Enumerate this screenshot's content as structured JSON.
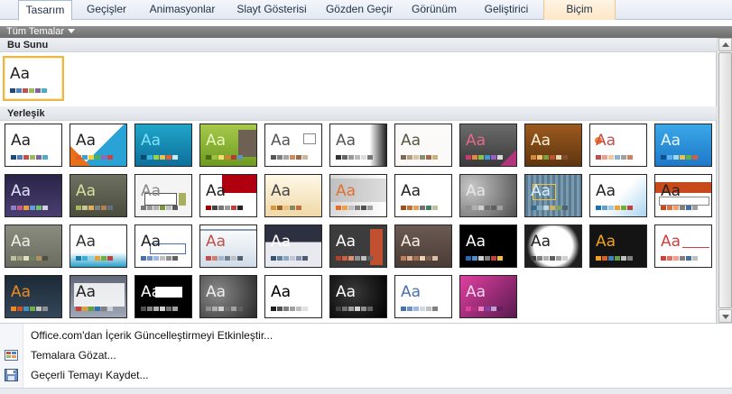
{
  "ribbon": {
    "tabs": [
      "Tasarım",
      "Geçişler",
      "Animasyonlar",
      "Slayt Gösterisi",
      "Gözden Geçir",
      "Görünüm",
      "Geliştirici",
      "Biçim"
    ],
    "active_tab": "Tasarım"
  },
  "filter": {
    "label": "Tüm Temalar"
  },
  "sections": {
    "current": "Bu Sunu",
    "builtin": "Yerleşik"
  },
  "current_theme": {
    "sample": "Aa"
  },
  "theme_sample": "Aa",
  "menu": {
    "items": [
      "Office.com'dan İçerik Güncelleştirmeyi Etkinleştir...",
      "Temalara Gözat...",
      "Geçerli Temayı Kaydet..."
    ]
  },
  "colors": {
    "accent": "#e8b84a",
    "ribbon_border": "#a9bbd2",
    "contextual_tab": "#fde6c6"
  }
}
